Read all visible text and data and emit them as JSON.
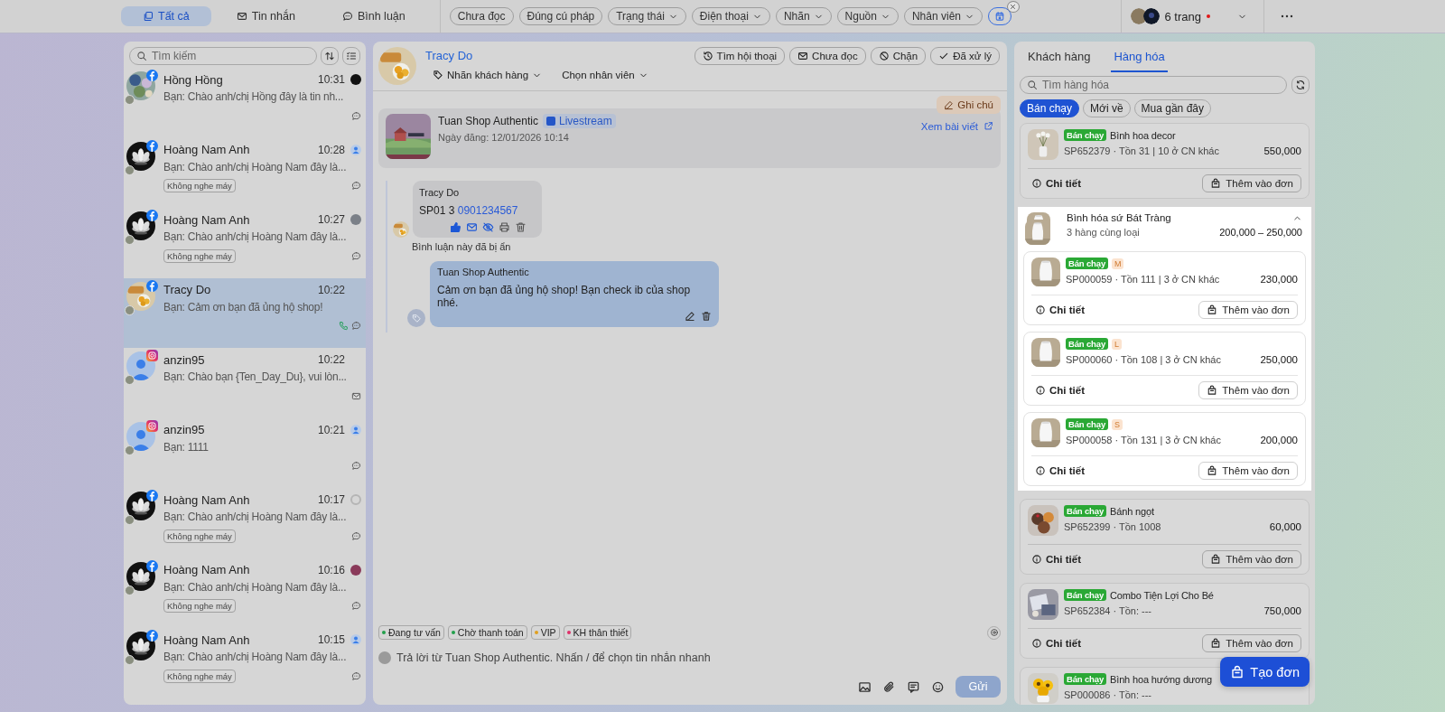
{
  "topbar": {
    "tabs": [
      {
        "label": "Tất cả",
        "selected": true
      },
      {
        "label": "Tin nhắn",
        "selected": false
      },
      {
        "label": "Bình luận",
        "selected": false
      }
    ],
    "filters": [
      {
        "label": "Chưa đọc",
        "dropdown": false
      },
      {
        "label": "Đúng cú pháp",
        "dropdown": false
      },
      {
        "label": "Trạng thái",
        "dropdown": true
      },
      {
        "label": "Điện thoại",
        "dropdown": true
      },
      {
        "label": "Nhãn",
        "dropdown": true
      },
      {
        "label": "Nguồn",
        "dropdown": true
      },
      {
        "label": "Nhân viên",
        "dropdown": true
      }
    ],
    "pages": {
      "label": "6 trang",
      "unread": true
    }
  },
  "conversations": [
    {
      "name": "Hồng Hồng",
      "time": "10:31",
      "preview": "Bạn: Chào anh/chị Hồng đây là tin nh...",
      "kind": "facebook",
      "selected": false
    },
    {
      "name": "Hoàng Nam Anh",
      "time": "10:28",
      "preview": "Bạn: Chào anh/chị Hoàng Nam đây là...",
      "kind": "facebook",
      "tag": "Không nghe máy",
      "selected": false
    },
    {
      "name": "Hoàng Nam Anh",
      "time": "10:27",
      "preview": "Bạn: Chào anh/chị Hoàng Nam đây là...",
      "kind": "facebook",
      "tag": "Không nghe máy",
      "selected": false
    },
    {
      "name": "Tracy Do",
      "time": "10:22",
      "preview": "Bạn: Cảm ơn bạn đã ủng hộ shop!",
      "kind": "facebook",
      "selected": true
    },
    {
      "name": "anzin95",
      "time": "10:22",
      "preview": "Bạn: Chào bạn {Ten_Day_Du}, vui lòn...",
      "kind": "instagram",
      "selected": false
    },
    {
      "name": "anzin95",
      "time": "10:21",
      "preview": "Bạn: 1111",
      "kind": "instagram",
      "selected": false
    },
    {
      "name": "Hoàng Nam Anh",
      "time": "10:17",
      "preview": "Bạn: Chào anh/chị Hoàng Nam đây là...",
      "kind": "facebook",
      "tag": "Không nghe máy",
      "selected": false
    },
    {
      "name": "Hoàng Nam Anh",
      "time": "10:16",
      "preview": "Bạn: Chào anh/chị Hoàng Nam đây là...",
      "kind": "facebook",
      "tag": "Không nghe máy",
      "selected": false
    },
    {
      "name": "Hoàng Nam Anh",
      "time": "10:15",
      "preview": "Bạn: Chào anh/chị Hoàng Nam đây là...",
      "kind": "facebook",
      "tag": "Không nghe máy",
      "selected": false
    }
  ],
  "search": {
    "placeholder": "Tìm kiếm"
  },
  "chat": {
    "contact": {
      "name": "Tracy Do"
    },
    "dropdowns": [
      "Nhãn khách hàng",
      "Chọn nhân viên"
    ],
    "actions": [
      "Tìm hội thoại",
      "Chưa đọc",
      "Chặn",
      "Đã xử lý"
    ],
    "note_button": "Ghi chú",
    "post": {
      "author": "Tuan Shop Authentic",
      "badge": "Livestream",
      "date": "Ngày đăng: 12/01/2026 10:14",
      "link": "Xem bài viết"
    },
    "comment": {
      "author": "Tracy Do",
      "text": "SP01 3",
      "phone": "0901234567",
      "status": "Bình luận này đã bị ẩn"
    },
    "reply": {
      "author": "Tuan Shop Authentic",
      "text": "Cảm ơn bạn đã ủng hộ shop! Bạn check ib của shop nhé."
    },
    "labels": [
      {
        "label": "Đang tư vấn",
        "color": "#22a04b"
      },
      {
        "label": "Chờ thanh toán",
        "color": "#22a04b"
      },
      {
        "label": "VIP",
        "color": "#e0a020"
      },
      {
        "label": "KH thân thiết",
        "color": "#e0306a"
      }
    ],
    "composer": {
      "placeholder": "Trả lời từ Tuan Shop Authentic. Nhấn / để chọn tin nhắn nhanh",
      "send": "Gửi"
    }
  },
  "products_panel": {
    "tabs": [
      {
        "label": "Khách hàng",
        "selected": false
      },
      {
        "label": "Hàng hóa",
        "selected": true
      }
    ],
    "search": {
      "placeholder": "Tìm hàng hóa"
    },
    "filters": [
      {
        "label": "Bán chạy",
        "selected": true
      },
      {
        "label": "Mới về",
        "selected": false
      },
      {
        "label": "Mua gần đây",
        "selected": false
      }
    ],
    "items": [
      {
        "kind": "product",
        "badge": "Bán chạy",
        "name": "Bình hoa decor",
        "meta": "SP652379 · Tồn 31 | 10 ở CN khác",
        "price": "550,000",
        "detail": "Chi tiết",
        "add": "Thêm vào đơn"
      },
      {
        "kind": "group",
        "name": "Bình hóa sứ Bát Tràng",
        "meta": "3 hàng cùng loại",
        "price": "200,000 – 250,000",
        "expanded": true,
        "variants": [
          {
            "badge": "Bán chạy",
            "size": "M",
            "meta": "SP000059  ·  Tồn 111 | 3 ở CN khác",
            "price": "230,000",
            "detail": "Chi tiết",
            "add": "Thêm vào đơn"
          },
          {
            "badge": "Bán chạy",
            "size": "L",
            "meta": "SP000060  ·  Tồn 108 | 3 ở CN khác",
            "price": "250,000",
            "detail": "Chi tiết",
            "add": "Thêm vào đơn"
          },
          {
            "badge": "Bán chạy",
            "size": "S",
            "meta": "SP000058  ·  Tồn 131 | 3 ở CN khác",
            "price": "200,000",
            "detail": "Chi tiết",
            "add": "Thêm vào đơn"
          }
        ]
      },
      {
        "kind": "product",
        "badge": "Bán chạy",
        "name": "Bánh ngọt",
        "meta": "SP652399 · Tồn 1008",
        "price": "60,000",
        "detail": "Chi tiết",
        "add": "Thêm vào đơn"
      },
      {
        "kind": "product",
        "badge": "Bán chạy",
        "name": "Combo Tiện Lợi Cho Bé",
        "meta": "SP652384 · Tồn: ---",
        "price": "750,000",
        "detail": "Chi tiết",
        "add": "Thêm vào đơn"
      },
      {
        "kind": "product",
        "badge": "Bán chạy",
        "name": "Bình hoa hướng dương",
        "meta": "SP000086 · Tồn: ---"
      }
    ],
    "create_order": "Tạo đơn"
  }
}
